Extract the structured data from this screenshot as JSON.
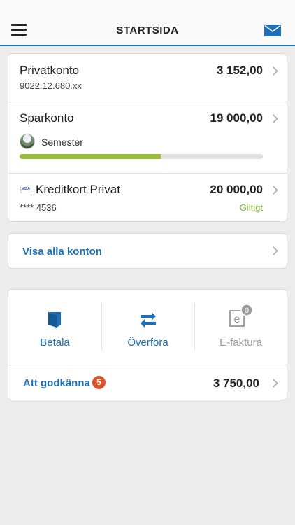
{
  "header": {
    "title": "STARTSIDA",
    "menu_icon": "menu-icon",
    "mail_icon": "mail-icon",
    "accent_color": "#1d6fb8"
  },
  "accounts": [
    {
      "name": "Privatkonto",
      "amount": "3 152,00",
      "number": "9022.12.680.xx"
    },
    {
      "name": "Sparkonto",
      "amount": "19 000,00",
      "goal": {
        "label": "Semester",
        "progress": 0.58,
        "color": "#9bbd3c"
      }
    },
    {
      "name": "Kreditkort Privat",
      "amount": "20 000,00",
      "card_number": "**** 4536",
      "status": "Giltigt",
      "card_icon": "visa-card-icon",
      "card_brand": "VISA"
    }
  ],
  "show_all": {
    "label": "Visa alla konton"
  },
  "actions": {
    "items": [
      {
        "label": "Betala",
        "icon": "pay-icon",
        "enabled": true
      },
      {
        "label": "Överföra",
        "icon": "transfer-icon",
        "enabled": true
      },
      {
        "label": "E-faktura",
        "icon": "e-invoice-icon",
        "enabled": false,
        "badge": "0"
      }
    ],
    "approve": {
      "label": "Att godkänna",
      "count": "5",
      "amount": "3 750,00"
    }
  }
}
